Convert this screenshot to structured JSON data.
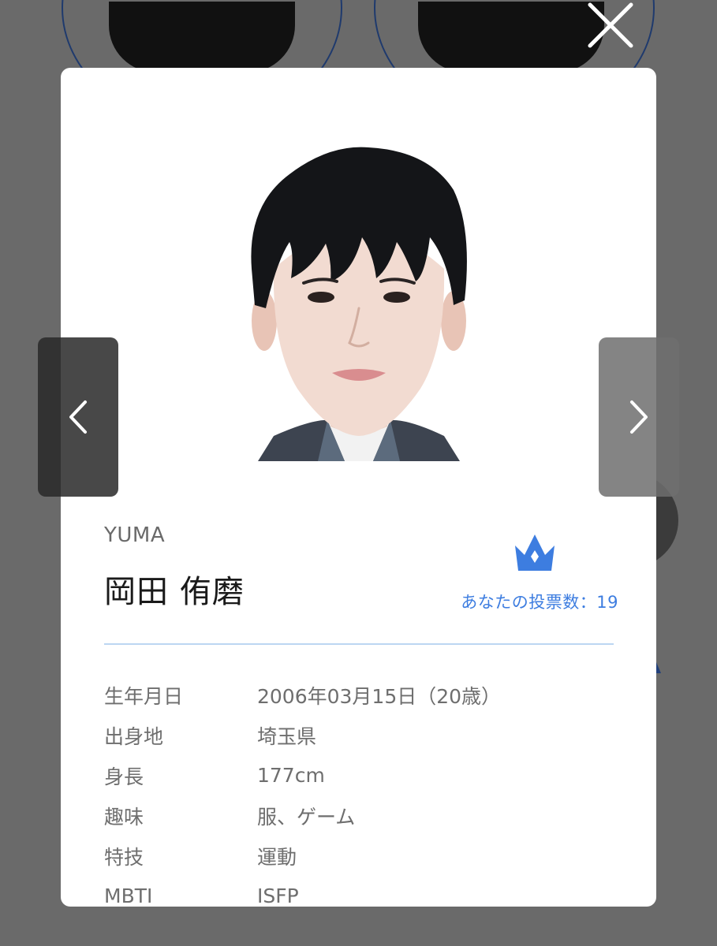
{
  "profile": {
    "romaji": "YUMA",
    "name": "岡田 侑磨"
  },
  "vote": {
    "label": "あなたの投票数：19",
    "count": 19,
    "icon": "crown-icon",
    "color": "#3d7de0"
  },
  "details": [
    {
      "label": "生年月日",
      "value": "2006年03月15日（20歳）"
    },
    {
      "label": "出身地",
      "value": "埼玉県"
    },
    {
      "label": "身長",
      "value": "177cm"
    },
    {
      "label": "趣味",
      "value": "服、ゲーム"
    },
    {
      "label": "特技",
      "value": "運動"
    },
    {
      "label": "MBTI",
      "value": "ISFP"
    }
  ],
  "controls": {
    "close_icon": "close-icon",
    "prev_icon": "chevron-left-icon",
    "next_icon": "chevron-right-icon"
  },
  "colors": {
    "accent": "#3d7de0",
    "divider": "#bcd6f2",
    "overlay": "#6a6a6a"
  }
}
